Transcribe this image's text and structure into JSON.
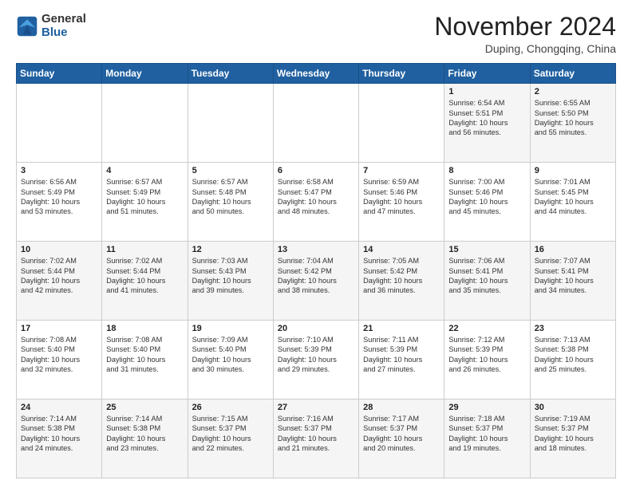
{
  "header": {
    "logo_general": "General",
    "logo_blue": "Blue",
    "month_title": "November 2024",
    "location": "Duping, Chongqing, China"
  },
  "days_of_week": [
    "Sunday",
    "Monday",
    "Tuesday",
    "Wednesday",
    "Thursday",
    "Friday",
    "Saturday"
  ],
  "weeks": [
    [
      {
        "day": "",
        "text": ""
      },
      {
        "day": "",
        "text": ""
      },
      {
        "day": "",
        "text": ""
      },
      {
        "day": "",
        "text": ""
      },
      {
        "day": "",
        "text": ""
      },
      {
        "day": "1",
        "text": "Sunrise: 6:54 AM\nSunset: 5:51 PM\nDaylight: 10 hours\nand 56 minutes."
      },
      {
        "day": "2",
        "text": "Sunrise: 6:55 AM\nSunset: 5:50 PM\nDaylight: 10 hours\nand 55 minutes."
      }
    ],
    [
      {
        "day": "3",
        "text": "Sunrise: 6:56 AM\nSunset: 5:49 PM\nDaylight: 10 hours\nand 53 minutes."
      },
      {
        "day": "4",
        "text": "Sunrise: 6:57 AM\nSunset: 5:49 PM\nDaylight: 10 hours\nand 51 minutes."
      },
      {
        "day": "5",
        "text": "Sunrise: 6:57 AM\nSunset: 5:48 PM\nDaylight: 10 hours\nand 50 minutes."
      },
      {
        "day": "6",
        "text": "Sunrise: 6:58 AM\nSunset: 5:47 PM\nDaylight: 10 hours\nand 48 minutes."
      },
      {
        "day": "7",
        "text": "Sunrise: 6:59 AM\nSunset: 5:46 PM\nDaylight: 10 hours\nand 47 minutes."
      },
      {
        "day": "8",
        "text": "Sunrise: 7:00 AM\nSunset: 5:46 PM\nDaylight: 10 hours\nand 45 minutes."
      },
      {
        "day": "9",
        "text": "Sunrise: 7:01 AM\nSunset: 5:45 PM\nDaylight: 10 hours\nand 44 minutes."
      }
    ],
    [
      {
        "day": "10",
        "text": "Sunrise: 7:02 AM\nSunset: 5:44 PM\nDaylight: 10 hours\nand 42 minutes."
      },
      {
        "day": "11",
        "text": "Sunrise: 7:02 AM\nSunset: 5:44 PM\nDaylight: 10 hours\nand 41 minutes."
      },
      {
        "day": "12",
        "text": "Sunrise: 7:03 AM\nSunset: 5:43 PM\nDaylight: 10 hours\nand 39 minutes."
      },
      {
        "day": "13",
        "text": "Sunrise: 7:04 AM\nSunset: 5:42 PM\nDaylight: 10 hours\nand 38 minutes."
      },
      {
        "day": "14",
        "text": "Sunrise: 7:05 AM\nSunset: 5:42 PM\nDaylight: 10 hours\nand 36 minutes."
      },
      {
        "day": "15",
        "text": "Sunrise: 7:06 AM\nSunset: 5:41 PM\nDaylight: 10 hours\nand 35 minutes."
      },
      {
        "day": "16",
        "text": "Sunrise: 7:07 AM\nSunset: 5:41 PM\nDaylight: 10 hours\nand 34 minutes."
      }
    ],
    [
      {
        "day": "17",
        "text": "Sunrise: 7:08 AM\nSunset: 5:40 PM\nDaylight: 10 hours\nand 32 minutes."
      },
      {
        "day": "18",
        "text": "Sunrise: 7:08 AM\nSunset: 5:40 PM\nDaylight: 10 hours\nand 31 minutes."
      },
      {
        "day": "19",
        "text": "Sunrise: 7:09 AM\nSunset: 5:40 PM\nDaylight: 10 hours\nand 30 minutes."
      },
      {
        "day": "20",
        "text": "Sunrise: 7:10 AM\nSunset: 5:39 PM\nDaylight: 10 hours\nand 29 minutes."
      },
      {
        "day": "21",
        "text": "Sunrise: 7:11 AM\nSunset: 5:39 PM\nDaylight: 10 hours\nand 27 minutes."
      },
      {
        "day": "22",
        "text": "Sunrise: 7:12 AM\nSunset: 5:39 PM\nDaylight: 10 hours\nand 26 minutes."
      },
      {
        "day": "23",
        "text": "Sunrise: 7:13 AM\nSunset: 5:38 PM\nDaylight: 10 hours\nand 25 minutes."
      }
    ],
    [
      {
        "day": "24",
        "text": "Sunrise: 7:14 AM\nSunset: 5:38 PM\nDaylight: 10 hours\nand 24 minutes."
      },
      {
        "day": "25",
        "text": "Sunrise: 7:14 AM\nSunset: 5:38 PM\nDaylight: 10 hours\nand 23 minutes."
      },
      {
        "day": "26",
        "text": "Sunrise: 7:15 AM\nSunset: 5:37 PM\nDaylight: 10 hours\nand 22 minutes."
      },
      {
        "day": "27",
        "text": "Sunrise: 7:16 AM\nSunset: 5:37 PM\nDaylight: 10 hours\nand 21 minutes."
      },
      {
        "day": "28",
        "text": "Sunrise: 7:17 AM\nSunset: 5:37 PM\nDaylight: 10 hours\nand 20 minutes."
      },
      {
        "day": "29",
        "text": "Sunrise: 7:18 AM\nSunset: 5:37 PM\nDaylight: 10 hours\nand 19 minutes."
      },
      {
        "day": "30",
        "text": "Sunrise: 7:19 AM\nSunset: 5:37 PM\nDaylight: 10 hours\nand 18 minutes."
      }
    ]
  ]
}
